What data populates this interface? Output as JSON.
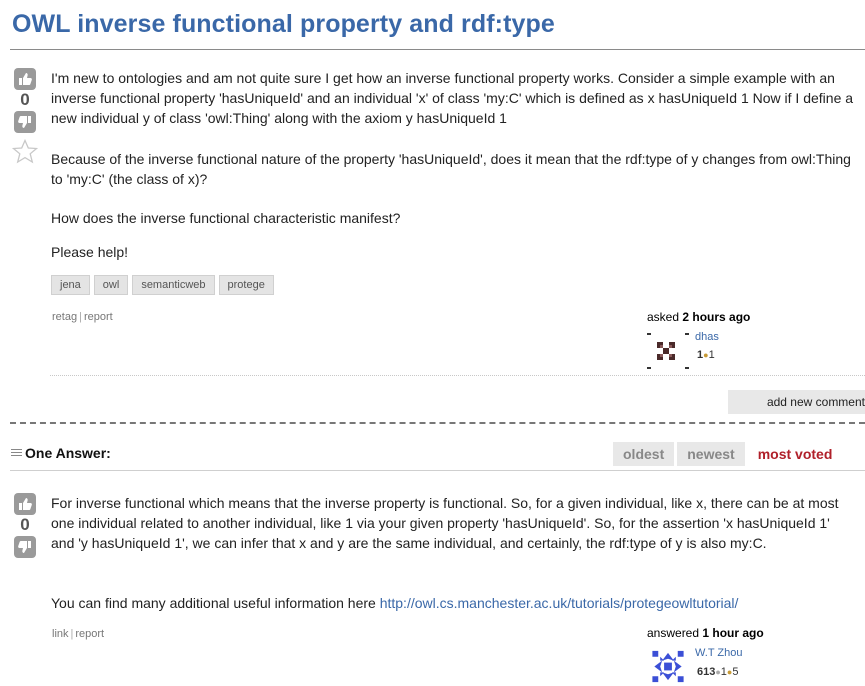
{
  "question": {
    "title": "OWL inverse functional property and rdf:type",
    "vote_count": "0",
    "paragraphs": [
      "I'm new to ontologies and am not quite sure I get how an inverse functional property works. Consider a simple example with an inverse functional property 'hasUniqueId' and an individual 'x' of class 'my:C' which is defined as x hasUniqueId 1 Now if I define a new individual y of class 'owl:Thing' along with the axiom y hasUniqueId 1",
      "Because of the inverse functional nature of the property 'hasUniqueId', does it mean that the rdf:type of y changes from owl:Thing to 'my:C' (the class of x)?",
      "How does the inverse functional characteristic manifest?",
      "Please help!"
    ],
    "tags": [
      "jena",
      "owl",
      "semanticweb",
      "protege"
    ],
    "links": {
      "retag": "retag",
      "sep": "|",
      "report": "report"
    },
    "asked_label": "asked",
    "asked_time": "2 hours ago",
    "user": {
      "name": "dhas",
      "rep": "1",
      "bronze": "1"
    },
    "add_comment": "add new comment"
  },
  "answers_header": {
    "label": "One Answer:",
    "tabs": [
      {
        "label": "oldest",
        "active": false
      },
      {
        "label": "newest",
        "active": false
      },
      {
        "label": "most voted",
        "active": true
      }
    ]
  },
  "answer": {
    "vote_count": "0",
    "paragraph1": "For inverse functional which means that the inverse property is functional. So, for a given individual, like x, there can be at most one individual related to another individual, like 1 via your given property 'hasUniqueId'. So, for the assertion 'x hasUniqueId 1' and 'y hasUniqueId 1', we can infer that x and y are the same individual, and certainly, the rdf:type of y is also my:C.",
    "paragraph2_prefix": "You can find many additional useful information here",
    "paragraph2_link": "http://owl.cs.manchester.ac.uk/tutorials/protegeowltutorial/",
    "links": {
      "link": "link",
      "sep": "|",
      "report": "report"
    },
    "answered_label": "answered",
    "answered_time": "1 hour ago",
    "user": {
      "name": "W.T Zhou",
      "rep": "613",
      "silver": "1",
      "bronze": "5"
    }
  },
  "colors": {
    "title": "#3a68a8",
    "link": "#3a68a8",
    "active_tab": "#b0202a",
    "vote_icon": "#9a9a9a"
  },
  "icons": [
    "thumb-up-icon",
    "thumb-down-icon",
    "favorite-star-icon",
    "list-lines-icon"
  ]
}
